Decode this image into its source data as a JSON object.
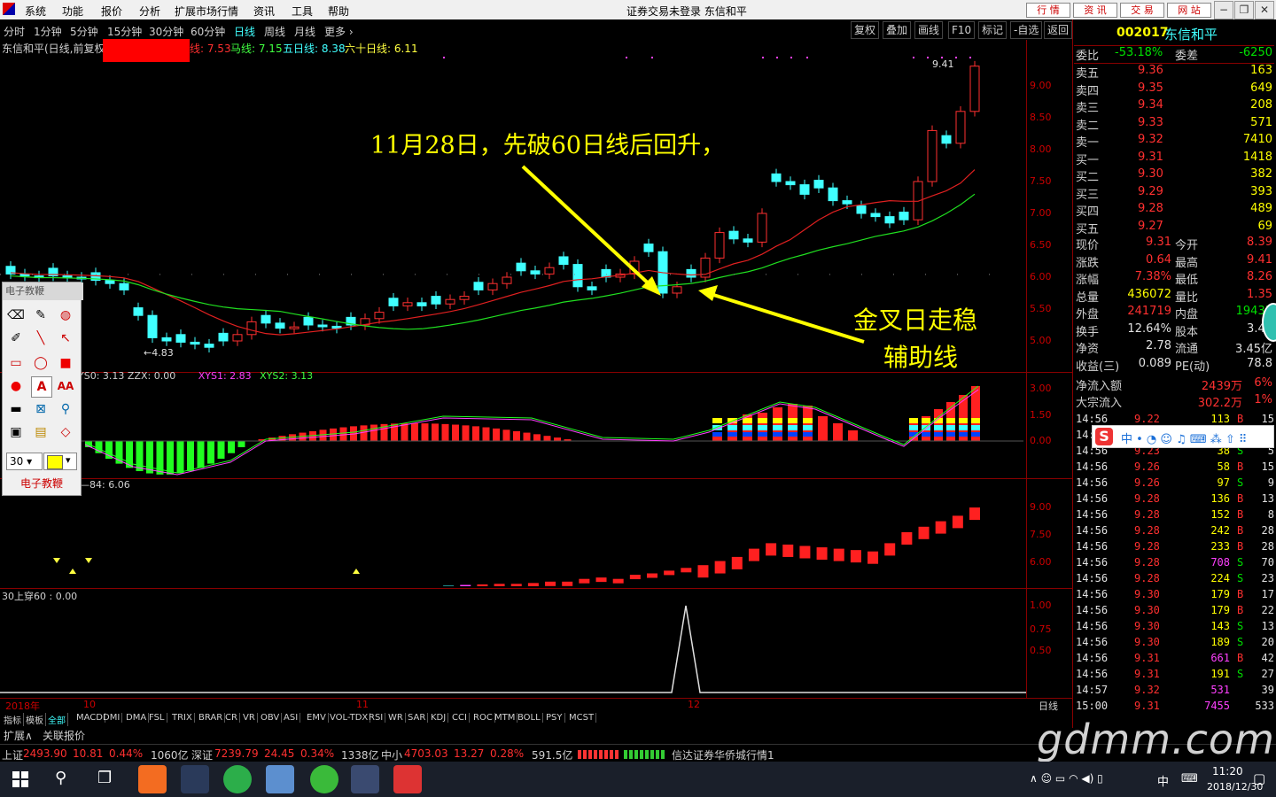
{
  "menu": {
    "items": [
      "系统",
      "功能",
      "报价",
      "分析",
      "扩展市场行情",
      "资讯",
      "工具",
      "帮助"
    ],
    "center_title": "证券交易未登录  东信和平",
    "right_buttons": [
      "行 情",
      "资 讯",
      "交 易",
      "网 站"
    ]
  },
  "periods": [
    "分时",
    "1分钟",
    "5分钟",
    "15分钟",
    "30分钟",
    "60分钟",
    "日线",
    "周线",
    "月线",
    "更多"
  ],
  "period_active": "日线",
  "tool_buttons": [
    "复权",
    "叠加",
    "画线",
    "F10",
    "标记",
    "-自选",
    "返回"
  ],
  "ma_legend": {
    "prefix": "东信和平(日线,前复权",
    "ma_hidden": "线: 7.53",
    "ma1": "马线: 7.15",
    "ma5": "五日线: 8.38",
    "ma60": "六十日线: 6.11"
  },
  "main_chart": {
    "high_label": "9.41",
    "low_label": "4.83",
    "y_ticks": [
      "9.00",
      "8.50",
      "8.00",
      "7.50",
      "7.00",
      "6.50",
      "6.00",
      "5.50",
      "5.00"
    ]
  },
  "annotations": {
    "top": "11月28日，先破60日线后回升，",
    "line1": "金叉日走稳",
    "line2": "辅助线"
  },
  "indicator1": {
    "legend": "YS0: 3.13   ZZX: 0.00",
    "xys1": "XYS1: 2.83",
    "xys2": "XYS2: 3.13",
    "y_ticks": [
      "3.00",
      "1.50",
      "0.00"
    ]
  },
  "indicator2": {
    "legend": "—84: 6.06",
    "y_ticks": [
      "9.00",
      "7.50",
      "6.00"
    ]
  },
  "indicator3": {
    "legend": "30上穿60 : 0.00",
    "y_ticks": [
      "1.00",
      "0.75",
      "0.50"
    ]
  },
  "x_axis": {
    "labels": [
      "2018年",
      "10",
      "11",
      "12"
    ],
    "period_label": "日线"
  },
  "stock": {
    "code": "002017",
    "name": "东信和平",
    "webi_label": "委比",
    "webi": "-53.18%",
    "weicha_label": "委差",
    "weicha": "-6250",
    "asks": [
      {
        "label": "卖五",
        "price": "9.36",
        "vol": "163"
      },
      {
        "label": "卖四",
        "price": "9.35",
        "vol": "649"
      },
      {
        "label": "卖三",
        "price": "9.34",
        "vol": "208"
      },
      {
        "label": "卖二",
        "price": "9.33",
        "vol": "571"
      },
      {
        "label": "卖一",
        "price": "9.32",
        "vol": "7410"
      }
    ],
    "bids": [
      {
        "label": "买一",
        "price": "9.31",
        "vol": "1418"
      },
      {
        "label": "买二",
        "price": "9.30",
        "vol": "382"
      },
      {
        "label": "买三",
        "price": "9.29",
        "vol": "393"
      },
      {
        "label": "买四",
        "price": "9.28",
        "vol": "489"
      },
      {
        "label": "买五",
        "price": "9.27",
        "vol": "69"
      }
    ],
    "stats": [
      {
        "l1": "现价",
        "v1": "9.31",
        "l2": "今开",
        "v2": "8.39",
        "c1": "red",
        "c2": "red"
      },
      {
        "l1": "涨跌",
        "v1": "0.64",
        "l2": "最高",
        "v2": "9.41",
        "c1": "red",
        "c2": "red"
      },
      {
        "l1": "涨幅",
        "v1": "7.38%",
        "l2": "最低",
        "v2": "8.26",
        "c1": "red",
        "c2": "red"
      },
      {
        "l1": "总量",
        "v1": "436072",
        "l2": "量比",
        "v2": "1.35",
        "c1": "yellow",
        "c2": "red"
      },
      {
        "l1": "外盘",
        "v1": "241719",
        "l2": "内盘",
        "v2": "19435",
        "c1": "red",
        "c2": "green"
      },
      {
        "l1": "换手",
        "v1": "12.64%",
        "l2": "股本",
        "v2": "3.46",
        "c1": "white",
        "c2": "white"
      },
      {
        "l1": "净资",
        "v1": "2.78",
        "l2": "流通",
        "v2": "3.45亿",
        "c1": "white",
        "c2": "white"
      },
      {
        "l1": "收益(三)",
        "v1": "0.089",
        "l2": "PE(动)",
        "v2": "78.8",
        "c1": "white",
        "c2": "white"
      }
    ],
    "flows": [
      {
        "label": "净流入额",
        "value": "2439万",
        "pct": "6%"
      },
      {
        "label": "大宗流入",
        "value": "302.2万",
        "pct": "1%"
      }
    ]
  },
  "ticks": [
    {
      "t": "14:56",
      "p": "9.22",
      "v": "113",
      "bs": "B",
      "n": "15"
    },
    {
      "t": "14:5",
      "p": "",
      "v": "",
      "bs": "",
      "n": ""
    },
    {
      "t": "14:56",
      "p": "9.23",
      "v": "38",
      "bs": "S",
      "n": "5"
    },
    {
      "t": "14:56",
      "p": "9.26",
      "v": "58",
      "bs": "B",
      "n": "15"
    },
    {
      "t": "14:56",
      "p": "9.26",
      "v": "97",
      "bs": "S",
      "n": "9"
    },
    {
      "t": "14:56",
      "p": "9.28",
      "v": "136",
      "bs": "B",
      "n": "13"
    },
    {
      "t": "14:56",
      "p": "9.28",
      "v": "152",
      "bs": "B",
      "n": "8"
    },
    {
      "t": "14:56",
      "p": "9.28",
      "v": "242",
      "bs": "B",
      "n": "28"
    },
    {
      "t": "14:56",
      "p": "9.28",
      "v": "233",
      "bs": "B",
      "n": "28"
    },
    {
      "t": "14:56",
      "p": "9.28",
      "v": "708",
      "bs": "S",
      "n": "70"
    },
    {
      "t": "14:56",
      "p": "9.28",
      "v": "224",
      "bs": "S",
      "n": "23"
    },
    {
      "t": "14:56",
      "p": "9.30",
      "v": "179",
      "bs": "B",
      "n": "17"
    },
    {
      "t": "14:56",
      "p": "9.30",
      "v": "179",
      "bs": "B",
      "n": "22"
    },
    {
      "t": "14:56",
      "p": "9.30",
      "v": "143",
      "bs": "S",
      "n": "13"
    },
    {
      "t": "14:56",
      "p": "9.30",
      "v": "189",
      "bs": "S",
      "n": "20"
    },
    {
      "t": "14:56",
      "p": "9.31",
      "v": "661",
      "bs": "B",
      "n": "42"
    },
    {
      "t": "14:56",
      "p": "9.31",
      "v": "191",
      "bs": "S",
      "n": "27"
    },
    {
      "t": "14:57",
      "p": "9.32",
      "v": "531",
      "bs": "",
      "n": "39"
    },
    {
      "t": "15:00",
      "p": "9.31",
      "v": "7455",
      "bs": "",
      "n": "533"
    }
  ],
  "indicator_tabs": [
    "指标",
    "模板",
    "全部",
    "MACD",
    "DMI",
    "DMA",
    "FSL",
    "TRIX",
    "BRAR",
    "CR",
    "VR",
    "OBV",
    "ASI",
    "EMV",
    "VOL-TDX",
    "RSI",
    "WR",
    "SAR",
    "KDJ",
    "CCI",
    "ROC",
    "MTM",
    "BOLL",
    "PSY",
    "MCST"
  ],
  "sub_tabs": [
    "扩展∧",
    "关联报价"
  ],
  "status": {
    "sh_label": "上证",
    "sh": "2493.90",
    "sh_chg": "10.81",
    "sh_pct": "0.44%",
    "sh_amt": "1060亿",
    "sz_label": "深证",
    "sz": "7239.79",
    "sz_chg": "24.45",
    "sz_pct": "0.34%",
    "sz_amt": "1338亿",
    "zx_label": "中小",
    "zx": "4703.03",
    "zx_chg": "13.27",
    "zx_pct": "0.28%",
    "zx_amt": "591.5亿",
    "broker": "信达证券华侨城行情1"
  },
  "palette": {
    "title": "电子教鞭",
    "size": "30",
    "footer": "电子教鞭"
  },
  "taskbar": {
    "time": "11:20",
    "date": "2018/12/30",
    "ime": "中"
  },
  "watermark": "gdmm.com"
}
